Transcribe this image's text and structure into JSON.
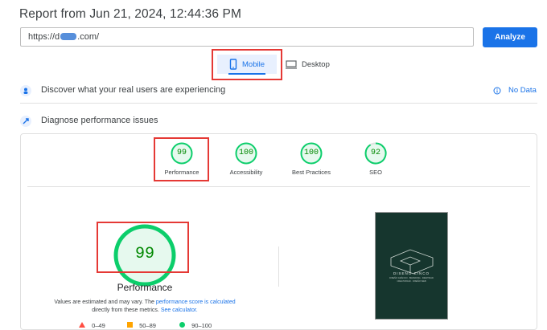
{
  "report_title": "Report from Jun 21, 2024, 12:44:36 PM",
  "url": {
    "prefix": "https://d",
    "suffix": ".com/"
  },
  "analyze_label": "Analyze",
  "tabs": {
    "mobile": "Mobile",
    "desktop": "Desktop"
  },
  "real_users": {
    "text": "Discover what your real users are experiencing",
    "status": "No Data"
  },
  "diagnose": {
    "text": "Diagnose performance issues"
  },
  "scores": [
    {
      "label": "Performance",
      "value": "99"
    },
    {
      "label": "Accessibility",
      "value": "100"
    },
    {
      "label": "Best Practices",
      "value": "100"
    },
    {
      "label": "SEO",
      "value": "92"
    }
  ],
  "main_gauge": {
    "value": "99",
    "label": "Performance"
  },
  "note": {
    "part1": "Values are estimated and may vary. The ",
    "link1": "performance score is calculated",
    "part2": "directly from these metrics. ",
    "link2": "See calculator."
  },
  "legend": {
    "fail": "0–49",
    "average": "50–89",
    "pass": "90–100"
  },
  "thumbnail": {
    "brand": "DISEÑO CINCO",
    "sub1": "DISEÑO GRÁFICO · BRANDING · IDENTIDAD",
    "sub2": "CREATIVIDAD · DISEÑO WEB"
  },
  "colors": {
    "pass": "#0cce6b",
    "pass_text": "#008800",
    "accent": "#1a73e8",
    "highlight": "#e53935"
  }
}
